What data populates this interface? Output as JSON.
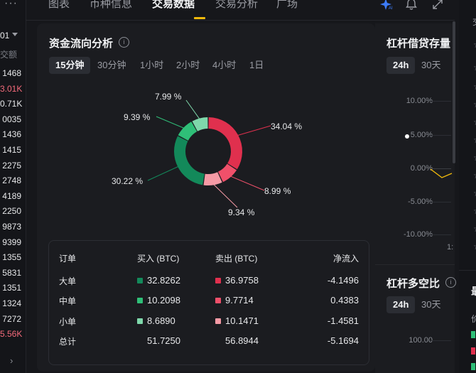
{
  "left_column": {
    "menu_dots": "···",
    "selected": "01",
    "header": "交额",
    "prices": [
      {
        "v": "1468",
        "c": "normal"
      },
      {
        "v": "3.01K",
        "c": "red"
      },
      {
        "v": "0.71K",
        "c": "normal"
      },
      {
        "v": "0035",
        "c": "normal"
      },
      {
        "v": "1436",
        "c": "normal"
      },
      {
        "v": "1415",
        "c": "normal"
      },
      {
        "v": "2275",
        "c": "normal"
      },
      {
        "v": "2748",
        "c": "normal"
      },
      {
        "v": "4189",
        "c": "normal"
      },
      {
        "v": "2250",
        "c": "normal"
      },
      {
        "v": "9873",
        "c": "normal"
      },
      {
        "v": "9399",
        "c": "normal"
      },
      {
        "v": "1355",
        "c": "normal"
      },
      {
        "v": "5831",
        "c": "normal"
      },
      {
        "v": "1351",
        "c": "normal"
      },
      {
        "v": "1324",
        "c": "normal"
      },
      {
        "v": "7272",
        "c": "normal"
      },
      {
        "v": "5.56K",
        "c": "red"
      }
    ],
    "footer_arrow": "›"
  },
  "tabs": [
    {
      "label": "图表",
      "active": false
    },
    {
      "label": "币种信息",
      "active": false
    },
    {
      "label": "交易数据",
      "active": true
    },
    {
      "label": "交易分析",
      "active": false
    },
    {
      "label": "广场",
      "active": false
    }
  ],
  "top_icons": [
    "ai-sparkle-icon",
    "bell-icon",
    "expand-icon"
  ],
  "fund_flow": {
    "title": "资金流向分析",
    "info": "i",
    "intervals": [
      {
        "label": "15分钟",
        "active": true
      },
      {
        "label": "30分钟",
        "active": false
      },
      {
        "label": "1小时",
        "active": false
      },
      {
        "label": "2小时",
        "active": false
      },
      {
        "label": "4小时",
        "active": false
      },
      {
        "label": "1日",
        "active": false
      }
    ],
    "donut": [
      {
        "label": "34.04 %",
        "value": 34.04,
        "color": "#e0304e"
      },
      {
        "label": "8.99 %",
        "value": 8.99,
        "color": "#f0506a"
      },
      {
        "label": "9.34 %",
        "value": 9.34,
        "color": "#f59aa5"
      },
      {
        "label": "30.22 %",
        "value": 30.22,
        "color": "#13895a"
      },
      {
        "label": "9.39 %",
        "value": 9.39,
        "color": "#2fbf78"
      },
      {
        "label": "7.99 %",
        "value": 7.99,
        "color": "#7fd8ab"
      }
    ],
    "table": {
      "headers": [
        "订单",
        "买入 (BTC)",
        "卖出 (BTC)",
        "净流入"
      ],
      "rows": [
        {
          "name": "大单",
          "buy": "32.8262",
          "buy_color": "#13895a",
          "sell": "36.9758",
          "sell_color": "#e0304e",
          "net": "-4.1496"
        },
        {
          "name": "中单",
          "buy": "10.2098",
          "buy_color": "#2fbf78",
          "sell": "9.7714",
          "sell_color": "#f0506a",
          "net": "0.4383"
        },
        {
          "name": "小单",
          "buy": "8.6890",
          "buy_color": "#7fd8ab",
          "sell": "10.1471",
          "sell_color": "#f59aa5",
          "net": "-1.4581"
        },
        {
          "name": "总计",
          "buy": "51.7250",
          "buy_color": "",
          "sell": "56.8944",
          "sell_color": "",
          "net": "-5.1694"
        }
      ]
    }
  },
  "leverage_loan": {
    "title": "杠杆借贷存量",
    "ranges": [
      {
        "label": "24h",
        "active": true
      },
      {
        "label": "30天",
        "active": false
      }
    ],
    "y_ticks": [
      "10.00%",
      "5.00%",
      "0.00%",
      "-5.00%",
      "-10.00%"
    ],
    "x_tick_partial": "1:"
  },
  "leverage_ratio": {
    "title": "杠杆多空比",
    "info": "i",
    "ranges": [
      {
        "label": "24h",
        "active": true
      },
      {
        "label": "30天",
        "active": false
      }
    ],
    "y_ticks": [
      "100.00"
    ]
  },
  "far_right": {
    "top_text": "交",
    "mid_text": "最",
    "side_text": "价"
  }
}
